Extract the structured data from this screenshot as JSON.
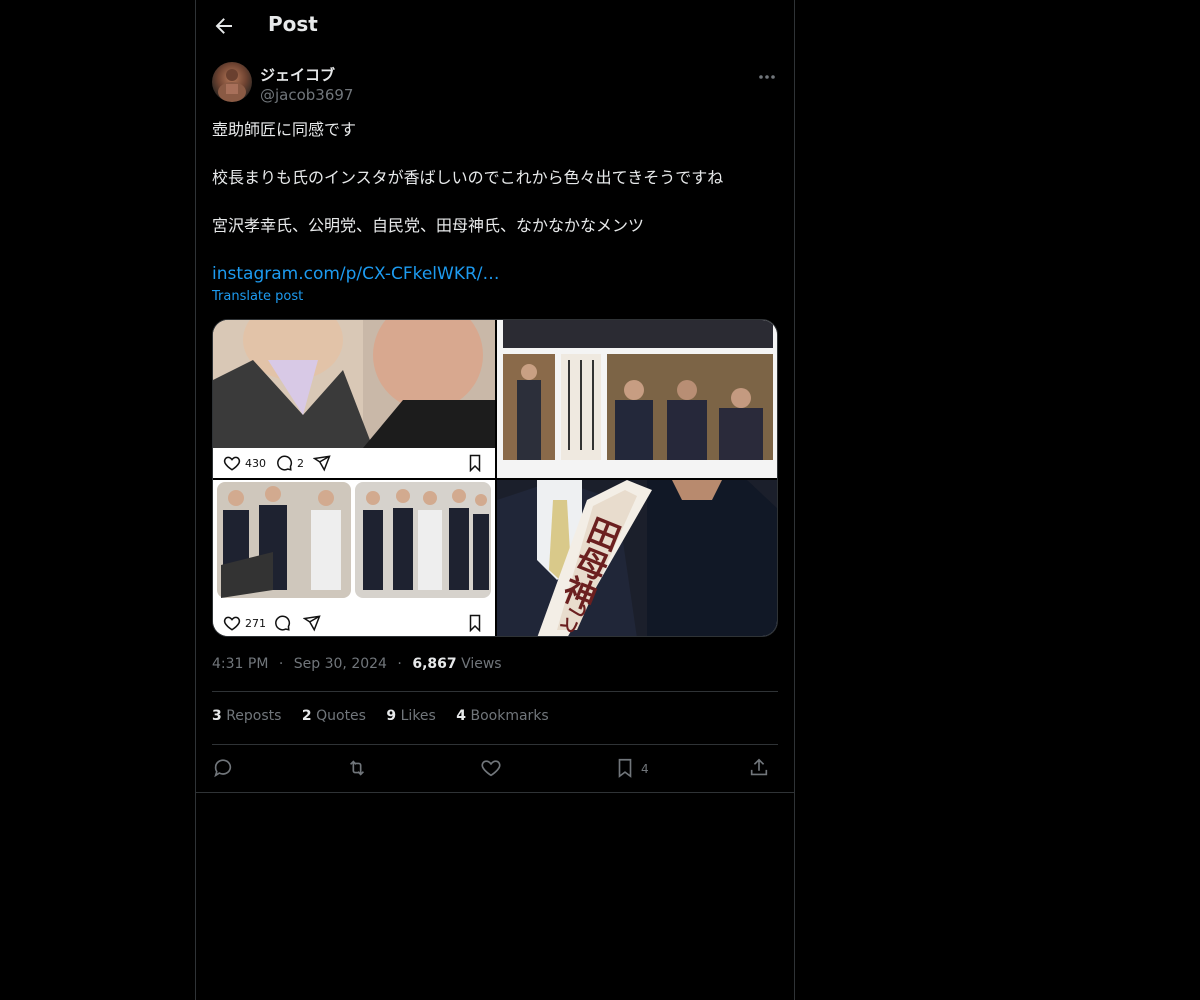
{
  "header": {
    "title": "Post"
  },
  "author": {
    "display_name": "ジェイコブ",
    "handle": "@jacob3697"
  },
  "post": {
    "lines": [
      "壺助師匠に同感です",
      "校長まりも氏のインスタが香ばしいのでこれから色々出てきそうですね",
      "宮沢孝幸氏、公明党、自民党、田母神氏、なかなかなメンツ"
    ],
    "link": "instagram.com/p/CX-CFkelWKR/…",
    "translate": "Translate post"
  },
  "media": {
    "tile1": {
      "likes": "430",
      "comments": "2"
    },
    "tile3": {
      "likes": "271"
    },
    "tile4": {
      "sash_text": "田母神",
      "sash_sub": "とし"
    }
  },
  "timestamp": {
    "time": "4:31 PM",
    "sep1": "·",
    "date": "Sep 30, 2024",
    "sep2": "·",
    "views": "6,867",
    "views_label": "Views"
  },
  "stats": {
    "reposts": "3",
    "reposts_label": "Reposts",
    "quotes": "2",
    "quotes_label": "Quotes",
    "likes": "9",
    "likes_label": "Likes",
    "bookmarks": "4",
    "bookmarks_label": "Bookmarks"
  },
  "actions": {
    "bookmark_count": "4"
  },
  "icons": {
    "back": "arrow-left-icon",
    "more": "more-icon",
    "reply": "reply-icon",
    "repost": "repost-icon",
    "like": "heart-icon",
    "bookmark": "bookmark-icon",
    "share": "share-icon"
  },
  "colors": {
    "accent": "#1d9bf0",
    "secondary_text": "#71767b",
    "border": "#2f3336"
  }
}
